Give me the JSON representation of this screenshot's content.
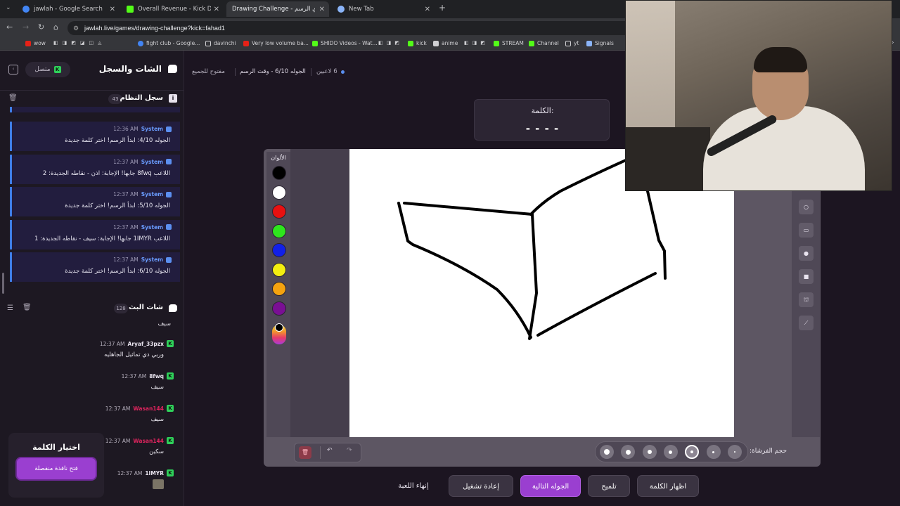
{
  "browser": {
    "tabs": [
      {
        "title": "jawlah - Google Search",
        "color": "#4285f4"
      },
      {
        "title": "Overall Revenue - Kick Dashbo",
        "color": "#53fc18"
      },
      {
        "title": "Drawing Challenge - تحدي الرسم",
        "color": "#9b59b6"
      },
      {
        "title": "New Tab",
        "color": "#8ab4f8"
      }
    ],
    "url": "jawlah.live/games/drawing-challenge?kick=fahad1",
    "bookmarks": [
      "wow",
      "fight club - Google...",
      "davinchi",
      "Very low volume ba...",
      "SHIDO Videos - Wat...",
      "kick",
      "anime",
      "STREAM",
      "Channel",
      "yt",
      "Signals"
    ]
  },
  "sidebar": {
    "title": "الشات والسجل",
    "status": "متصل",
    "log_title": "سجل النظام",
    "log_count": "43",
    "log_items": [
      {
        "time": "12:36 AM",
        "sender": "System",
        "text": "الجوله 4/10: ابدأ الرسم! اختر كلمة جديدة"
      },
      {
        "time": "12:37 AM",
        "sender": "System",
        "text": "اللاعب 8fwq جابها! الإجابة: اذن - نقاطه الجديدة: 2"
      },
      {
        "time": "12:37 AM",
        "sender": "System",
        "text": "الجوله 5/10: ابدأ الرسم! اختر كلمة جديدة"
      },
      {
        "time": "12:37 AM",
        "sender": "System",
        "text": "اللاعب 1IMYR جابها! الإجابة: سيف - نقاطه الجديدة: 1"
      },
      {
        "time": "12:37 AM",
        "sender": "System",
        "text": "الجوله 6/10: ابدأ الرسم! اختر كلمة جديدة"
      }
    ],
    "chat_title": "شات البث",
    "chat_count": "128",
    "chat_partial": "سيف",
    "chat_messages": [
      {
        "time": "12:37 AM",
        "user": "Aryaf_33pzx",
        "user_color": "#e8e3ee",
        "text": "وربي ذي تماثيل الجاهليه"
      },
      {
        "time": "12:37 AM",
        "user": "8fwq",
        "user_color": "#e8e3ee",
        "text": "سيف"
      },
      {
        "time": "12:37 AM",
        "user": "Wasan144",
        "user_color": "#e0245e",
        "text": "سيف"
      },
      {
        "time": "12:37 AM",
        "user": "Wasan144",
        "user_color": "#e0245e",
        "text": "سكين"
      },
      {
        "time": "12:37 AM",
        "user": "1IMYR",
        "user_color": "#e8e3ee",
        "text": ""
      }
    ],
    "word_pick_title": "اختيار الكلمة",
    "word_pick_button": "فتح نافذة منفصلة"
  },
  "game": {
    "players": "6 لاعبين",
    "round_info": "الجوله 6/10 - وقت الرسم",
    "mode": "مفتوح للجميع",
    "word_label": "الكلمة:",
    "word_mask": "- - - -",
    "colors_label": "الألوان",
    "colors": [
      "#000000",
      "#ffffff",
      "#e81010",
      "#2ee51d",
      "#1220e8",
      "#f3ee10",
      "#f5a30f",
      "#7a0f94"
    ],
    "brush_label": "حجم الفرشاة:",
    "brush_selected_index": 4
  },
  "actions": {
    "end_game": "إنهاء اللعبة",
    "restart": "إعادة تشغيل",
    "next_round": "الجوله التالية",
    "hint": "تلميح",
    "reveal": "اظهار الكلمة"
  },
  "accent": "#9a3fd0"
}
